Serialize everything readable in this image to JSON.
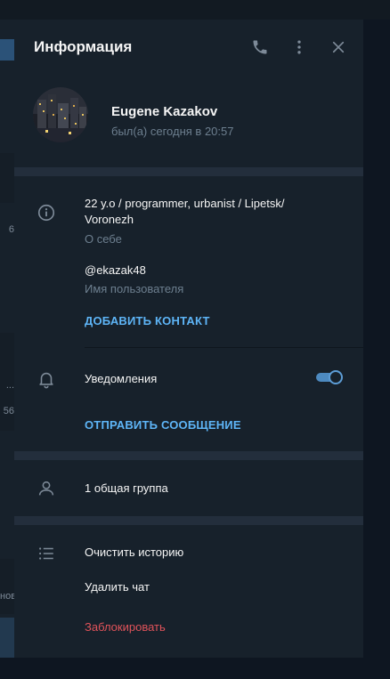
{
  "background": {
    "peek": [
      "6",
      "...",
      "56",
      "нов"
    ]
  },
  "panel": {
    "title": "Информация"
  },
  "header_icons": [
    "phone-icon",
    "more-vertical-icon",
    "close-icon"
  ],
  "profile": {
    "name": "Eugene Kazakov",
    "status": "был(а) сегодня в 20:57"
  },
  "info": {
    "bio_line1": "22 y.o / programmer, urbanist / Lipetsk/",
    "bio_line2": "Voronezh",
    "bio_label": "О себе",
    "username": "@ekazak48",
    "username_label": "Имя пользователя",
    "add_contact": "ДОБАВИТЬ КОНТАКТ"
  },
  "notifications": {
    "label": "Уведомления",
    "enabled": true,
    "send_message": "ОТПРАВИТЬ СООБЩЕНИЕ"
  },
  "groups": {
    "label": "1 общая группа"
  },
  "actions": {
    "clear_history": "Очистить историю",
    "delete_chat": "Удалить чат",
    "block": "Заблокировать"
  },
  "colors": {
    "panel_bg": "#17212b",
    "accent": "#5eb5f7",
    "danger": "#e0535a",
    "muted": "#6d7f8f",
    "toggle": "#4d8ac0"
  }
}
